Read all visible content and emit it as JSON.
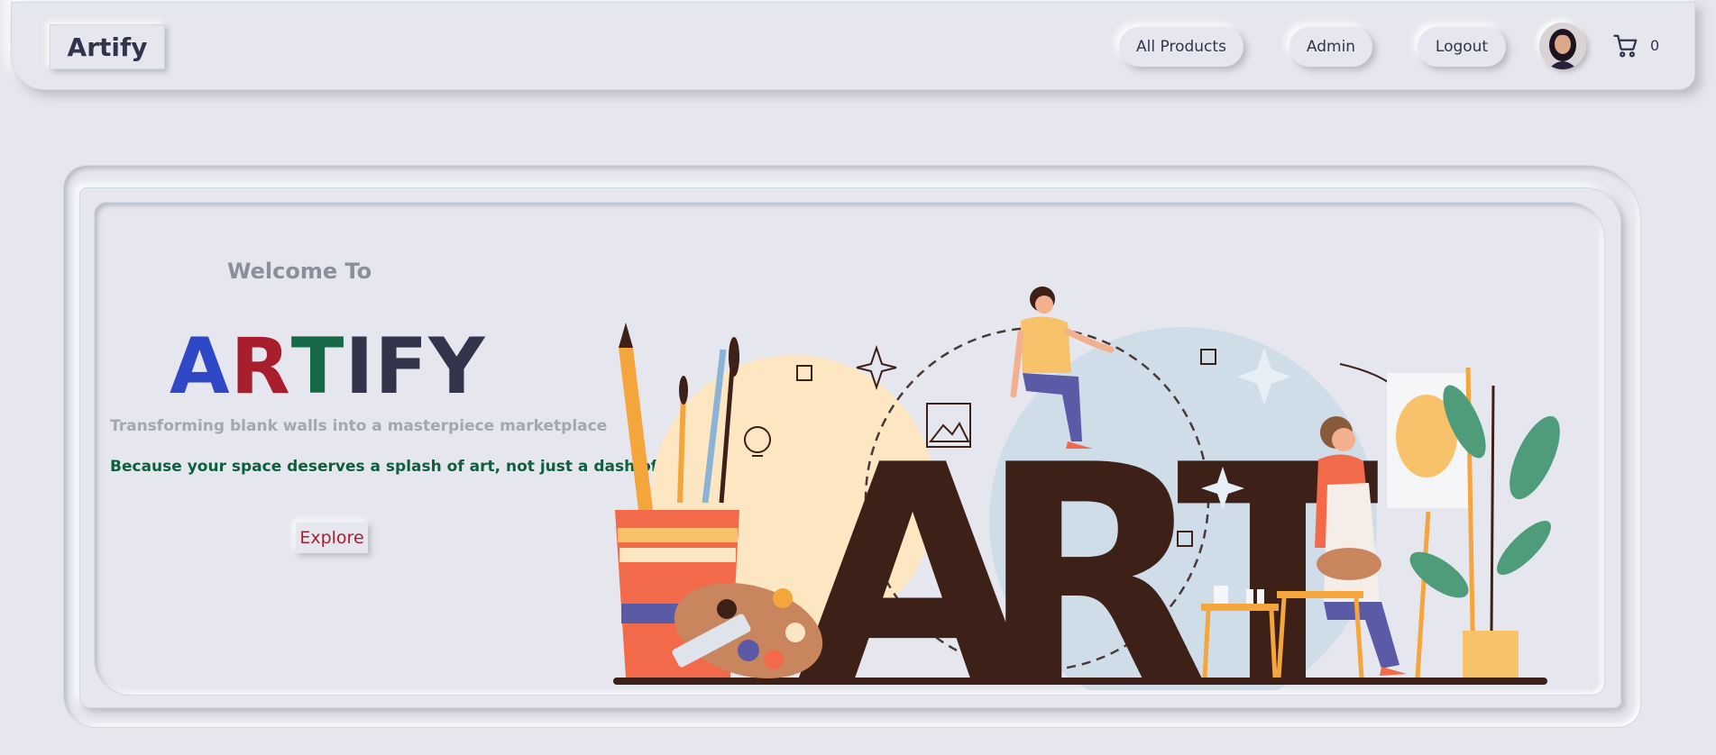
{
  "navbar": {
    "brand": "Artify",
    "links": [
      {
        "label": "All Products"
      },
      {
        "label": "Admin"
      },
      {
        "label": "Logout"
      }
    ],
    "cart_count": "0"
  },
  "hero": {
    "welcome": "Welcome To",
    "title_letters": [
      {
        "char": "A",
        "color": "#2f48c5"
      },
      {
        "char": "R",
        "color": "#a91e2c"
      },
      {
        "char": "T",
        "color": "#156b47"
      },
      {
        "char": "I",
        "color": "#31344b"
      },
      {
        "char": "F",
        "color": "#31344b"
      },
      {
        "char": "Y",
        "color": "#31344b"
      }
    ],
    "tagline": "Transforming blank walls into a masterpiece marketplace",
    "subline": "Because your space deserves a splash of art, not just a dash of color!",
    "explore": "Explore",
    "illustration_text": "ART"
  },
  "icons": {
    "cart": "shopping-cart-icon",
    "avatar": "user-avatar"
  },
  "colors": {
    "background": "#e6e7ee",
    "text": "#31344b",
    "blue": "#2f48c5",
    "red": "#a91e2c",
    "green": "#156b47",
    "art_brown": "#3d2118"
  }
}
